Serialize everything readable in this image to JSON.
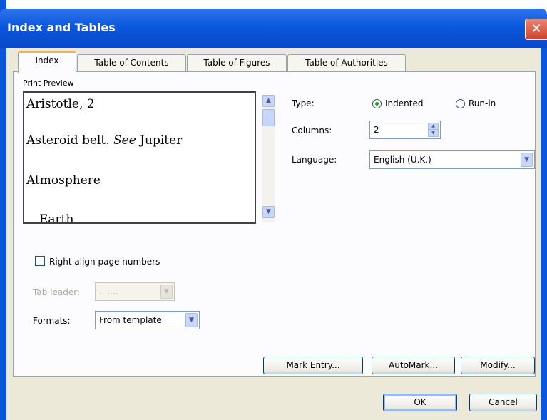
{
  "window": {
    "title": "Index and Tables",
    "close_glyph": "✕"
  },
  "tabs": [
    {
      "label": "Index",
      "active": true
    },
    {
      "label": "Table of Contents",
      "active": false
    },
    {
      "label": "Table of Figures",
      "active": false
    },
    {
      "label": "Table of Authorities",
      "active": false
    }
  ],
  "preview": {
    "label": "Print Preview",
    "lines": [
      {
        "text": "Aristotle, 2"
      },
      {
        "text_before": "Asteroid belt. ",
        "italic": "See",
        "text_after": " Jupiter"
      },
      {
        "text": "Atmosphere"
      },
      {
        "text": "Earth"
      }
    ]
  },
  "options": {
    "type_label": "Type:",
    "type_options": [
      "Indented",
      "Run-in"
    ],
    "type_selected": "Indented",
    "columns_label": "Columns:",
    "columns_value": "2",
    "language_label": "Language:",
    "language_value": "English (U.K.)"
  },
  "right_align": {
    "label": "Right align page numbers",
    "checked": false
  },
  "tab_leader": {
    "label": "Tab leader:",
    "value": ".......",
    "enabled": false
  },
  "formats": {
    "label": "Formats:",
    "value": "From template"
  },
  "buttons": {
    "mark_entry": "Mark Entry...",
    "automark": "AutoMark...",
    "modify": "Modify...",
    "ok": "OK",
    "cancel": "Cancel"
  },
  "icons": {
    "scroll_up": "▲",
    "scroll_down": "▼",
    "dropdown": "▼",
    "spin_up": "▲",
    "spin_down": "▼"
  },
  "colors": {
    "titlebar": "#0b58dd",
    "dialog_face": "#ece9d8",
    "close_button": "#d0432a",
    "radio_dot": "#21a121",
    "active_tab_highlight": "#f3b33d"
  }
}
